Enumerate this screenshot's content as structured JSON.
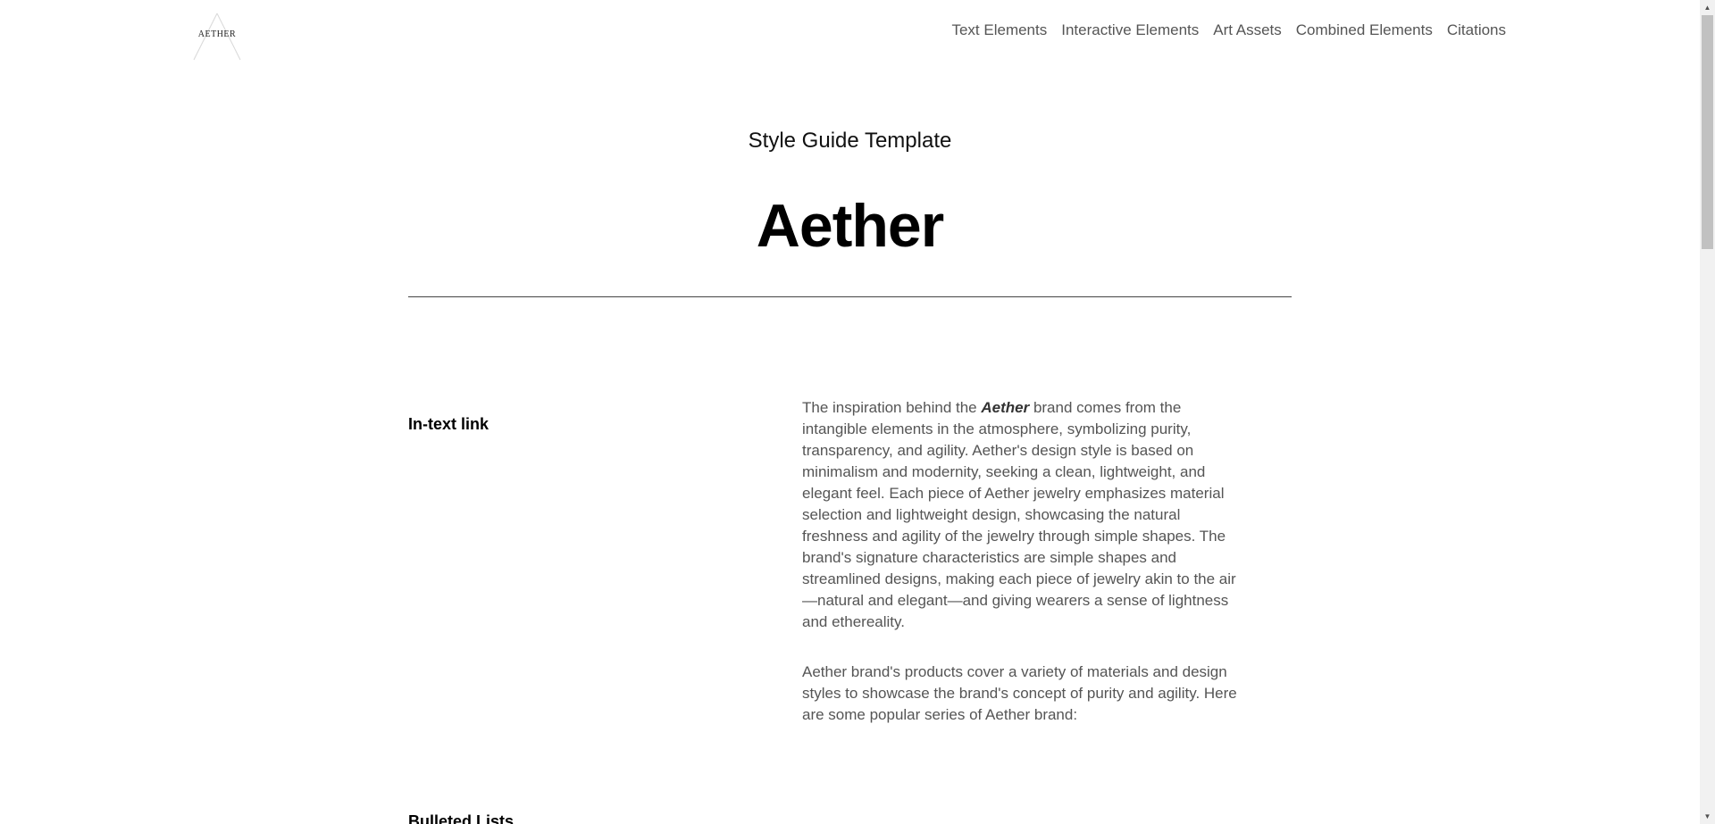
{
  "header": {
    "logo_text": "AETHER",
    "nav": [
      {
        "label": "Text Elements"
      },
      {
        "label": "Interactive Elements"
      },
      {
        "label": "Art Assets"
      },
      {
        "label": "Combined Elements"
      },
      {
        "label": "Citations"
      }
    ]
  },
  "hero": {
    "subtitle": "Style Guide Template",
    "title": "Aether"
  },
  "sections": {
    "in_text_link": {
      "label": "In-text link",
      "para1_prefix": "The inspiration behind the ",
      "para1_brand": "Aether",
      "para1_suffix": " brand comes from the intangible elements in the atmosphere, symbolizing purity, transparency, and agility. Aether's design style is based on minimalism and modernity, seeking a clean, lightweight, and elegant feel. Each piece of Aether jewelry emphasizes material selection and lightweight design, showcasing the natural freshness and agility of the jewelry through simple shapes. The brand's signature characteristics are simple shapes and streamlined designs, making each piece of jewelry akin to the air—natural and elegant—and giving wearers a sense of lightness and ethereality.",
      "para2": "Aether brand's products cover a variety of materials and design styles to showcase the brand's concept of purity and agility. Here are some popular series of Aether brand:"
    },
    "bulleted_lists": {
      "label": "Bulleted Lists"
    }
  },
  "colors": {
    "text_primary": "#000000",
    "text_secondary": "#555555",
    "rule": "#444444"
  }
}
